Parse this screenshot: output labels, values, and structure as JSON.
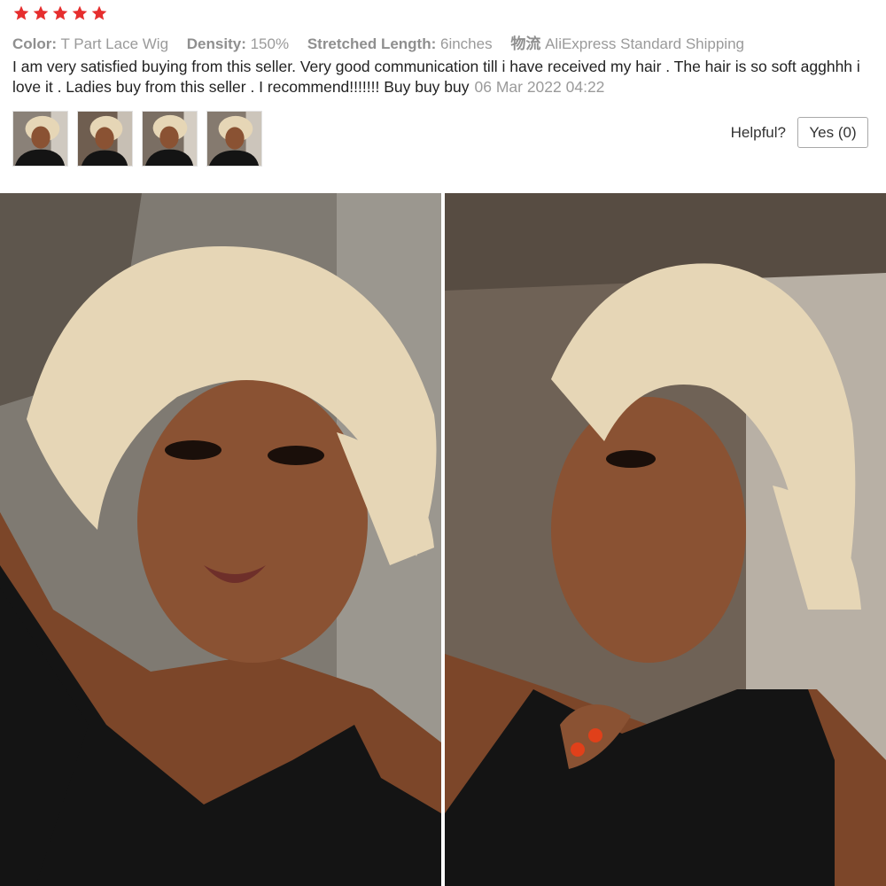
{
  "review": {
    "rating": 5,
    "star_color": "#e62e2e",
    "attributes": [
      {
        "label": "Color:",
        "value": "T Part Lace Wig"
      },
      {
        "label": "Density:",
        "value": "150%"
      },
      {
        "label": "Stretched Length:",
        "value": "6inches"
      },
      {
        "label": "物流",
        "value": "AliExpress Standard Shipping"
      }
    ],
    "comment": "I am very satisfied buying from this seller. Very good communication till i have received my hair . The hair is so soft agghhh i love it . Ladies buy from this seller . I recommend!!!!!!! Buy buy buy",
    "date": "06 Mar 2022 04:22",
    "thumbnail_count": 4,
    "helpful_label": "Helpful?",
    "yes_button_label": "Yes (0)"
  },
  "photos": {
    "count": 2,
    "hair_color": "#e6d6b6",
    "skin_color": "#8a5233",
    "top_color": "#111111",
    "wall_color": "#7f7a72"
  }
}
